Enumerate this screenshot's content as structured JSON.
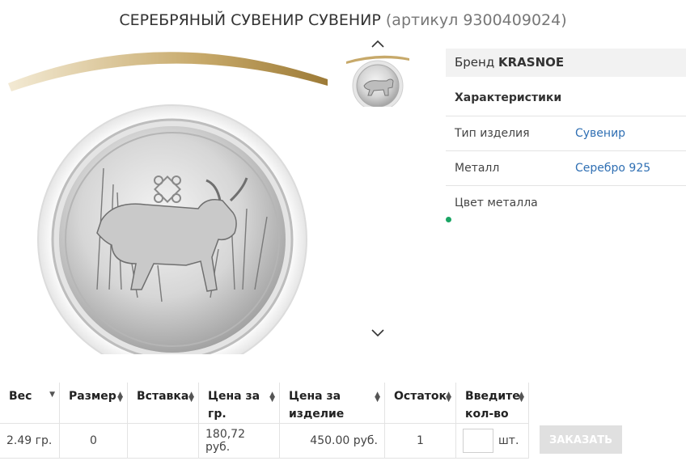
{
  "product": {
    "title": "СЕРЕБРЯНЫЙ СУВЕНИР СУВЕНИР",
    "article": "(артикул 9300409024)"
  },
  "specs": {
    "brand_label": "Бренд",
    "brand_value": "KRASNOE",
    "heading": "Характеристики",
    "rows": [
      {
        "key": "Тип изделия",
        "value": "Сувенир"
      },
      {
        "key": "Металл",
        "value": "Серебро 925"
      },
      {
        "key": "Цвет металла",
        "value": ""
      }
    ]
  },
  "table": {
    "headers": [
      "Вес",
      "Размер",
      "Вставка",
      "Цена за гр.",
      "Цена за изделие",
      "Остаток",
      "Введите кол-во"
    ],
    "row": {
      "weight": "2.49 гр.",
      "size": "0",
      "insert": "",
      "price_per_gram": "180,72 руб.",
      "price_item": "450.00 руб.",
      "stock": "1",
      "qty": "",
      "unit": "шт."
    }
  },
  "order_button": "ЗАКАЗАТЬ",
  "icons": {
    "up": "chevron-up-icon",
    "down": "chevron-down-icon",
    "sort": "sort-arrows-icon"
  },
  "colors": {
    "link": "#2f6fb3",
    "accent_gold": "#b49552",
    "status_green": "#1aa564",
    "button_bg": "#e0e0e0"
  }
}
